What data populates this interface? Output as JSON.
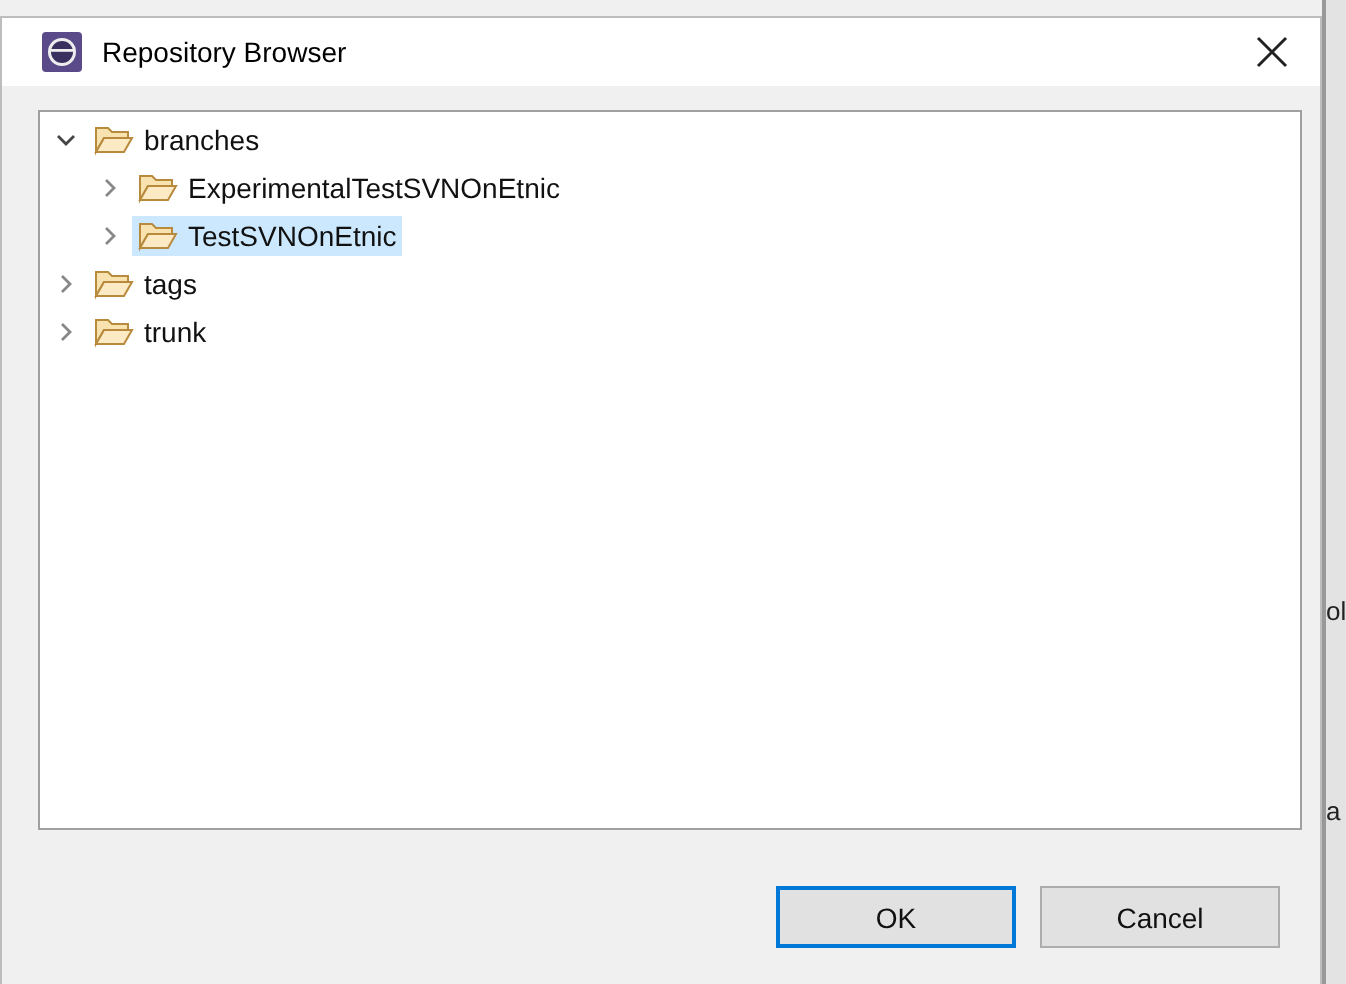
{
  "window": {
    "title": "Repository Browser"
  },
  "tree": [
    {
      "label": "branches",
      "expanded": true,
      "selected": false,
      "children": [
        {
          "label": "ExperimentalTestSVNOnEtnic",
          "expanded": false,
          "selected": false
        },
        {
          "label": "TestSVNOnEtnic",
          "expanded": false,
          "selected": true
        }
      ]
    },
    {
      "label": "tags",
      "expanded": false,
      "selected": false
    },
    {
      "label": "trunk",
      "expanded": false,
      "selected": false
    }
  ],
  "buttons": [
    {
      "label": "OK",
      "default": true
    },
    {
      "label": "Cancel",
      "default": false
    }
  ],
  "background_fragments": [
    "ol",
    "a"
  ]
}
